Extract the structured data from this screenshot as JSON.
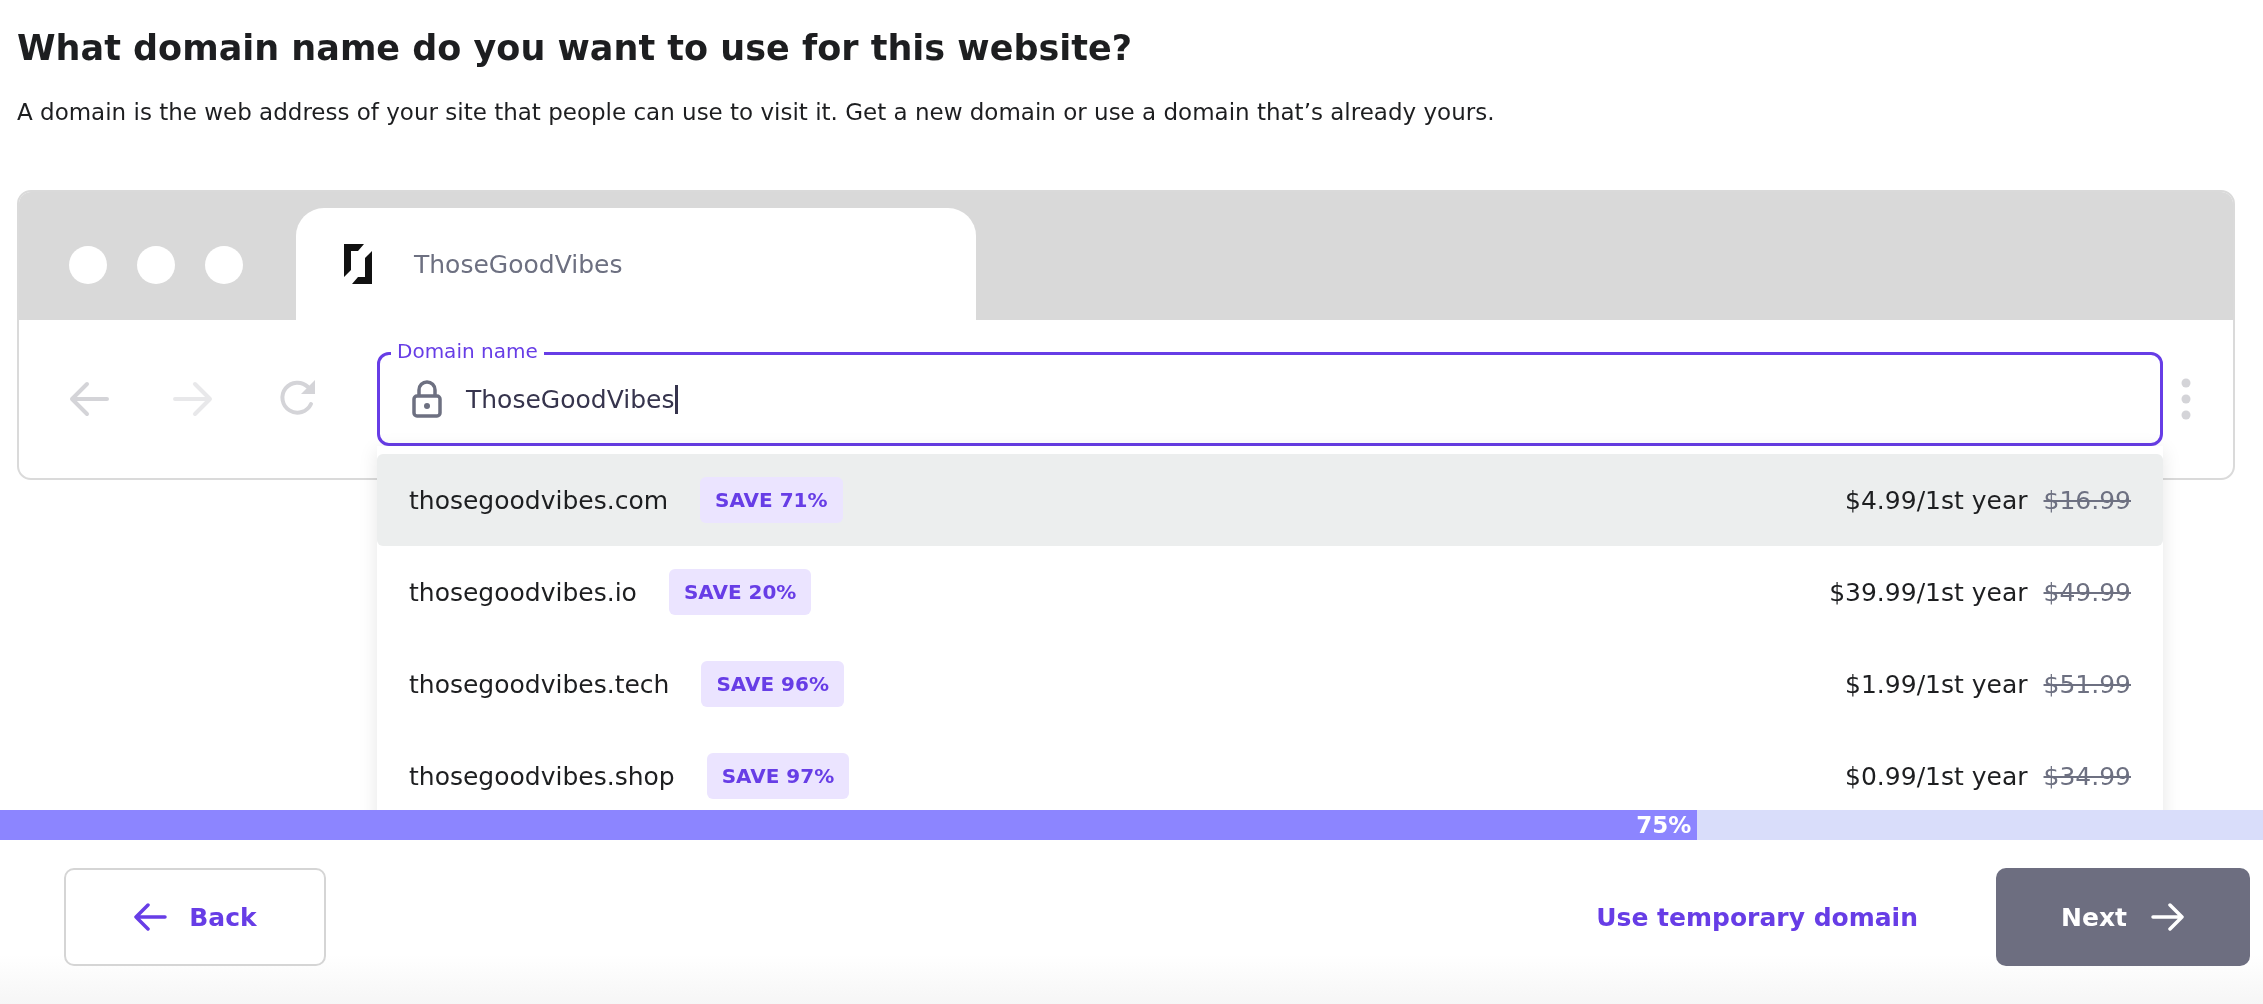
{
  "heading": "What domain name do you want to use for this website?",
  "description": "A domain is the web address of your site that people can use to visit it. Get a new domain or use a domain that’s already yours.",
  "browser": {
    "tab_title": "ThoseGoodVibes"
  },
  "domain_field": {
    "label": "Domain name",
    "value": "ThoseGoodVibes"
  },
  "suggestions": [
    {
      "domain": "thosegoodvibes.com",
      "badge": "SAVE 71%",
      "price": "$4.99/1st year",
      "old_price": "$16.99",
      "selected": true
    },
    {
      "domain": "thosegoodvibes.io",
      "badge": "SAVE 20%",
      "price": "$39.99/1st year",
      "old_price": "$49.99",
      "selected": false
    },
    {
      "domain": "thosegoodvibes.tech",
      "badge": "SAVE 96%",
      "price": "$1.99/1st year",
      "old_price": "$51.99",
      "selected": false
    },
    {
      "domain": "thosegoodvibes.shop",
      "badge": "SAVE 97%",
      "price": "$0.99/1st year",
      "old_price": "$34.99",
      "selected": false
    }
  ],
  "progress": {
    "level": 0.75,
    "label": "75%"
  },
  "footer": {
    "back_button": "Back",
    "temporary_link": "Use temporary domain",
    "next_button": "Next"
  }
}
